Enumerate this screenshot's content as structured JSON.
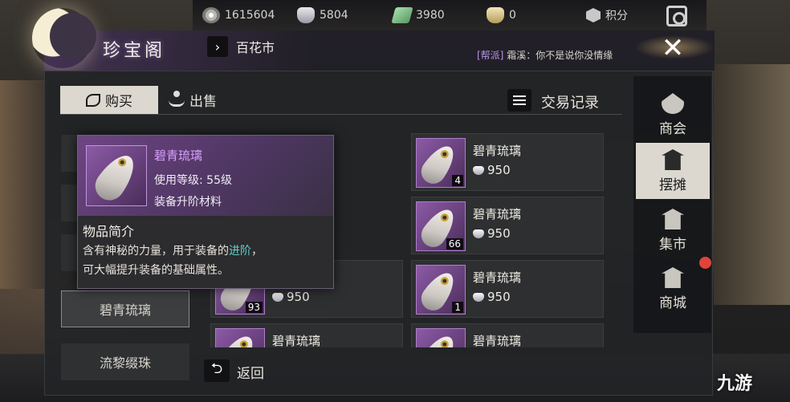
{
  "currencies": [
    {
      "icon": "coin-icon",
      "value": "1615604"
    },
    {
      "icon": "silver-ingot-icon",
      "value": "5804"
    },
    {
      "icon": "jade-icon",
      "value": "3980"
    },
    {
      "icon": "gold-ingot-icon",
      "value": "0"
    },
    {
      "icon": "badge-icon",
      "value": "积分"
    }
  ],
  "header": {
    "title": "珍宝阁",
    "breadcrumb": "百花市",
    "sys_tag": "[帮派]",
    "sys_msg": "霜溪：你不是说你没情缘"
  },
  "tabs": {
    "buy": "购买",
    "sell": "出售"
  },
  "trade_log": "交易记录",
  "categories": [
    "碧青琉璃",
    "流黎缀珠"
  ],
  "items": [
    {
      "name": "碧青琉璃",
      "price": "950",
      "qty": "4"
    },
    {
      "name": "碧青琉璃",
      "price": "950",
      "qty": "66"
    },
    {
      "name": "碧青琉璃",
      "price": "950",
      "qty": "1"
    },
    {
      "name": "碧青琉璃",
      "price": "950",
      "qty": "93"
    },
    {
      "name": "碧青琉璃",
      "price": "",
      "qty": ""
    },
    {
      "name": "碧青琉璃",
      "price": "",
      "qty": ""
    }
  ],
  "back_label": "返回",
  "right_nav": [
    "商会",
    "摆摊",
    "集市",
    "商城"
  ],
  "tooltip": {
    "name": "碧青琉璃",
    "level": "使用等级: 55级",
    "type": "装备升阶材料",
    "section": "物品简介",
    "desc_a": "含有神秘的力量，用于装备的",
    "desc_hl": "进阶",
    "desc_b": "，",
    "desc_c": "可大幅提升装备的基础属性。"
  },
  "watermark": "九游",
  "colors": {
    "rarity_purple": "#d9a0ff",
    "highlight_teal": "#5ed1c4",
    "alert_red": "#e0433b"
  }
}
